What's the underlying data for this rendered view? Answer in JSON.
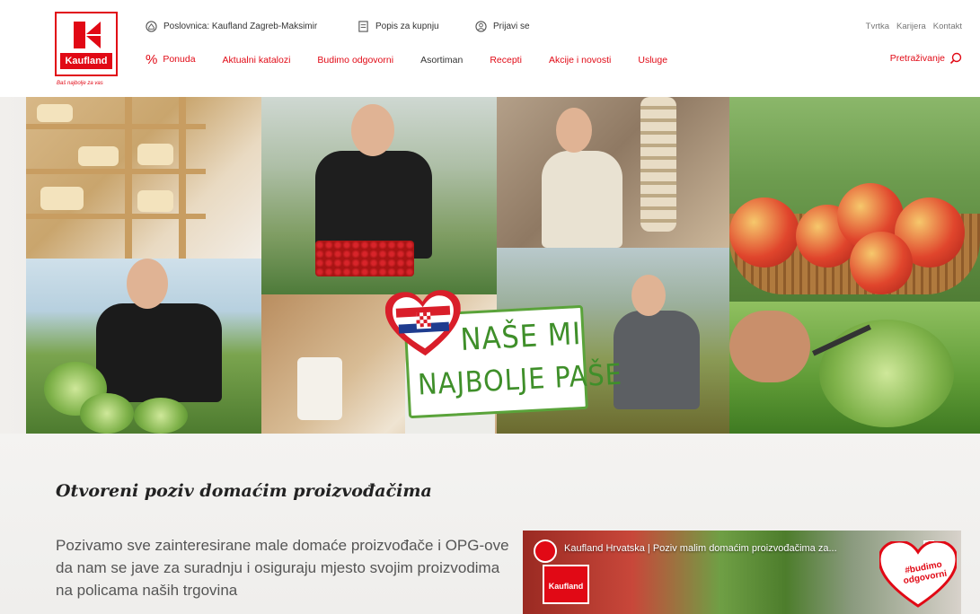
{
  "brand": {
    "logo_text": "Kaufland",
    "slogan": "Baš najbolje za vas",
    "accent_color": "#e10915",
    "green_color": "#3f8f2a"
  },
  "utility": {
    "store_label": "Poslovnica: Kaufland Zagreb-Maksimir",
    "store_icon": "store-pin-icon",
    "list_label": "Popis za kupnju",
    "list_icon": "shopping-list-icon",
    "login_label": "Prijavi se",
    "login_icon": "user-icon"
  },
  "top_links": [
    "Tvrtka",
    "Karijera",
    "Kontakt"
  ],
  "nav": [
    {
      "label": "Ponuda",
      "icon": "%"
    },
    {
      "label": "Aktualni katalozi"
    },
    {
      "label": "Budimo odgovorni"
    },
    {
      "label": "Asortiman"
    },
    {
      "label": "Recepti"
    },
    {
      "label": "Akcije i novosti"
    },
    {
      "label": "Usluge"
    }
  ],
  "search": {
    "label": "Pretraživanje",
    "icon": "search-icon"
  },
  "hero_badge": {
    "line1": "NAŠE MI",
    "line2": "NAJBOLJE PAŠE"
  },
  "intro": {
    "title": "Otvoreni poziv domaćim proizvođačima",
    "text": "Pozivamo sve zainteresirane male domaće proizvođače i OPG-ove da nam se jave za suradnju i osiguraju mjesto svojim proizvodima na policama naših trgovina"
  },
  "video": {
    "title": "Kaufland Hrvatska | Poziv malim domaćim proizvođačima za...",
    "badge": "Kaufland",
    "heart_text": "#budimo odgovorni"
  }
}
